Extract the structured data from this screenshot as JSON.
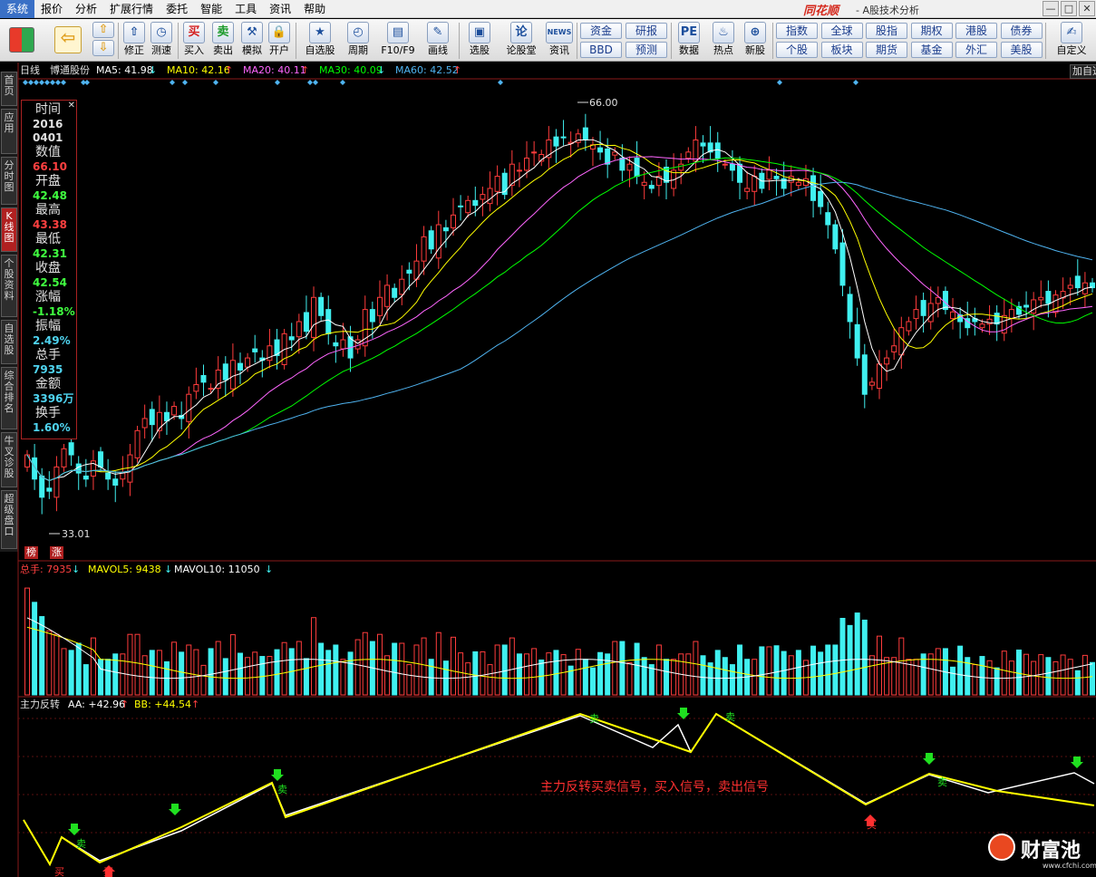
{
  "menu": {
    "items": [
      "系统",
      "报价",
      "分析",
      "扩展行情",
      "委托",
      "智能",
      "工具",
      "资讯",
      "帮助"
    ],
    "brand": "同花顺",
    "app_title": "- A股技术分析"
  },
  "toolbar": {
    "buttons": [
      {
        "label": "修正",
        "icon": "⇧"
      },
      {
        "label": "测速",
        "icon": "◷"
      },
      {
        "label": "买入",
        "icon": "买"
      },
      {
        "label": "卖出",
        "icon": "卖"
      },
      {
        "label": "模拟",
        "icon": "⚒"
      },
      {
        "label": "开户",
        "icon": "🔒"
      },
      {
        "label": "自选股",
        "icon": "★"
      },
      {
        "label": "周期",
        "icon": "◴"
      },
      {
        "label": "F10/F9",
        "icon": "▤"
      },
      {
        "label": "画线",
        "icon": "✎"
      },
      {
        "label": "选股",
        "icon": "▣"
      },
      {
        "label": "论股堂",
        "icon": "论"
      },
      {
        "label": "资讯",
        "icon": "NEWS"
      },
      {
        "label": "数据",
        "icon": "PE"
      },
      {
        "label": "热点",
        "icon": "♨"
      },
      {
        "label": "新股",
        "icon": "⊕"
      },
      {
        "label": "自定义",
        "icon": "✍"
      }
    ],
    "grid_small": [
      {
        "label": "资金"
      },
      {
        "label": "研报"
      },
      {
        "label": "BBD"
      },
      {
        "label": "预测"
      }
    ],
    "grid_market": [
      {
        "label": "指数"
      },
      {
        "label": "全球"
      },
      {
        "label": "股指"
      },
      {
        "label": "期权"
      },
      {
        "label": "港股"
      },
      {
        "label": "债券"
      },
      {
        "label": "个股"
      },
      {
        "label": "板块"
      },
      {
        "label": "期货"
      },
      {
        "label": "基金"
      },
      {
        "label": "外汇"
      },
      {
        "label": "美股"
      }
    ]
  },
  "left_tabs": [
    {
      "label": "首页",
      "active": false
    },
    {
      "label": "应用",
      "active": false
    },
    {
      "label": "分时图",
      "active": false
    },
    {
      "label": "K线图",
      "active": true
    },
    {
      "label": "个股资料",
      "active": false
    },
    {
      "label": "自选股",
      "active": false
    },
    {
      "label": "综合排名",
      "active": false
    },
    {
      "label": "牛叉诊股",
      "active": false
    },
    {
      "label": "超级盘口",
      "active": false
    }
  ],
  "kline_header": {
    "period": "日线",
    "stock_name": "博通股份",
    "ma": [
      {
        "label": "MA5: 41.98",
        "arrow": "↓",
        "color": "#ffffff"
      },
      {
        "label": "MA10: 42.16",
        "arrow": "↑",
        "color": "#ffff00"
      },
      {
        "label": "MA20: 40.11",
        "arrow": "↑",
        "color": "#ff66ff"
      },
      {
        "label": "MA30: 40.09",
        "arrow": "↓",
        "color": "#00ff00"
      },
      {
        "label": "MA60: 42.52",
        "arrow": "↑",
        "color": "#4fb3f0"
      }
    ],
    "add_button": "加自选"
  },
  "info_box": {
    "rows": [
      {
        "label": "时间",
        "value": "2016",
        "color": "#e0e0e0"
      },
      {
        "label": "",
        "value": "0401",
        "color": "#e0e0e0"
      },
      {
        "label": "数值",
        "value": "66.10",
        "color": "#ff4040"
      },
      {
        "label": "开盘",
        "value": "42.48",
        "color": "#40ff40"
      },
      {
        "label": "最高",
        "value": "43.38",
        "color": "#ff4040"
      },
      {
        "label": "最低",
        "value": "42.31",
        "color": "#40ff40"
      },
      {
        "label": "收盘",
        "value": "42.54",
        "color": "#40ff40"
      },
      {
        "label": "涨幅",
        "value": "-1.18%",
        "color": "#40ff40"
      },
      {
        "label": "振幅",
        "value": "2.49%",
        "color": "#4fd4f0"
      },
      {
        "label": "总手",
        "value": "7935",
        "color": "#4fd4f0"
      },
      {
        "label": "金额",
        "value": "3396万",
        "color": "#4fd4f0"
      },
      {
        "label": "换手",
        "value": "1.60%",
        "color": "#4fd4f0"
      }
    ]
  },
  "price_markers": {
    "high_label": "66.00",
    "low_label": "33.01"
  },
  "bottom_badges": [
    "榜",
    "涨"
  ],
  "volume_header": [
    {
      "label": "总手: 7935",
      "arrow": "↓",
      "color": "#ff4040"
    },
    {
      "label": "MAVOL5: 9438",
      "arrow": "↓",
      "color": "#ffff00"
    },
    {
      "label": "MAVOL10: 11050",
      "arrow": "↓",
      "color": "#ffffff"
    }
  ],
  "indicator_header": {
    "name": "主力反转",
    "aa": "AA: +42.96",
    "aa_arrow": "↑",
    "bb": "BB: +44.54",
    "bb_arrow": "↑"
  },
  "signal_caption": "主力反转买卖信号，买入信号，卖出信号",
  "signal_labels": {
    "buy": "买",
    "sell": "卖"
  },
  "watermark": {
    "name": "财富池",
    "url": "www.cfchi.com"
  },
  "colors": {
    "up": "#ff3c3c",
    "down": "#40f0f0",
    "ma5": "#ffffff",
    "ma10": "#ffff00",
    "ma20": "#ff66ff",
    "ma30": "#00ff00",
    "ma60": "#4fb3f0",
    "signal_yellow": "#ffff00",
    "signal_white": "#ffffff"
  },
  "chart_data": {
    "type": "candlestick",
    "price_range": [
      33.01,
      66.0
    ],
    "closes": [
      38,
      36,
      34.5,
      35,
      37,
      38.5,
      38,
      36.5,
      36,
      37.5,
      37,
      36,
      35.5,
      36.5,
      38,
      40,
      41,
      40.5,
      41.5,
      40.8,
      42,
      41,
      43,
      43.8,
      44,
      43.5,
      45,
      44.2,
      45.8,
      45,
      46,
      46.5,
      45.8,
      47,
      46.2,
      48,
      47.5,
      49,
      48.2,
      51,
      49.5,
      48,
      47,
      47.5,
      46,
      47.5,
      50,
      49,
      51,
      52,
      51,
      52.5,
      53,
      54,
      56,
      55,
      57,
      56.5,
      57.8,
      58.5,
      59,
      58.6,
      59.5,
      60,
      61,
      59.5,
      62,
      61.5,
      62.5,
      63,
      62.8,
      64,
      63.5,
      64.2,
      63.8,
      64.5,
      64,
      63.6,
      63,
      62,
      63,
      61.5,
      62,
      61,
      60.5,
      60,
      61,
      60.5,
      61.5,
      62,
      63,
      64,
      63.5,
      63,
      62.5,
      62,
      61.5,
      60.5,
      60,
      61,
      60,
      61.5,
      60.8,
      60,
      61,
      60.5,
      60.8,
      59,
      58.5,
      57,
      55,
      52,
      49,
      46,
      43,
      44,
      45.5,
      46,
      47,
      48.5,
      49,
      50,
      49.5,
      50.5,
      51,
      50,
      49.8,
      49,
      48.5,
      49,
      48.8,
      49.2,
      48.8,
      49.5,
      50,
      49.6,
      50.2,
      50.8,
      51,
      50.5,
      51.2,
      51.5,
      52,
      51.8,
      52.2,
      51.8
    ]
  }
}
